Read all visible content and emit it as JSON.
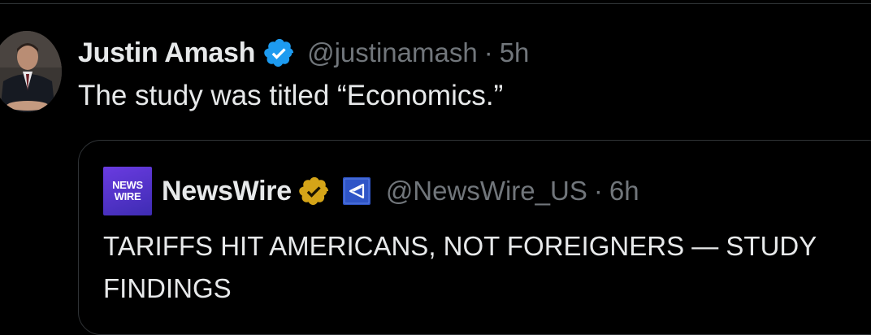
{
  "tweet": {
    "author": {
      "display_name": "Justin Amash",
      "handle": "@justinamash",
      "verified_color": "#1d9bf0"
    },
    "separator": "·",
    "time": "5h",
    "text": "The study was titled “Economics.”"
  },
  "quoted_tweet": {
    "logo_text_line1": "NEWS",
    "logo_text_line2": "WIRE",
    "display_name": "NewsWire",
    "verified_color": "#d4a418",
    "affiliate_badge_color": "#2f55c7",
    "handle": "@NewsWire_US",
    "separator": "·",
    "time": "6h",
    "text": "TARIFFS HIT AMERICANS, NOT FOREIGNERS — STUDY FINDINGS"
  }
}
